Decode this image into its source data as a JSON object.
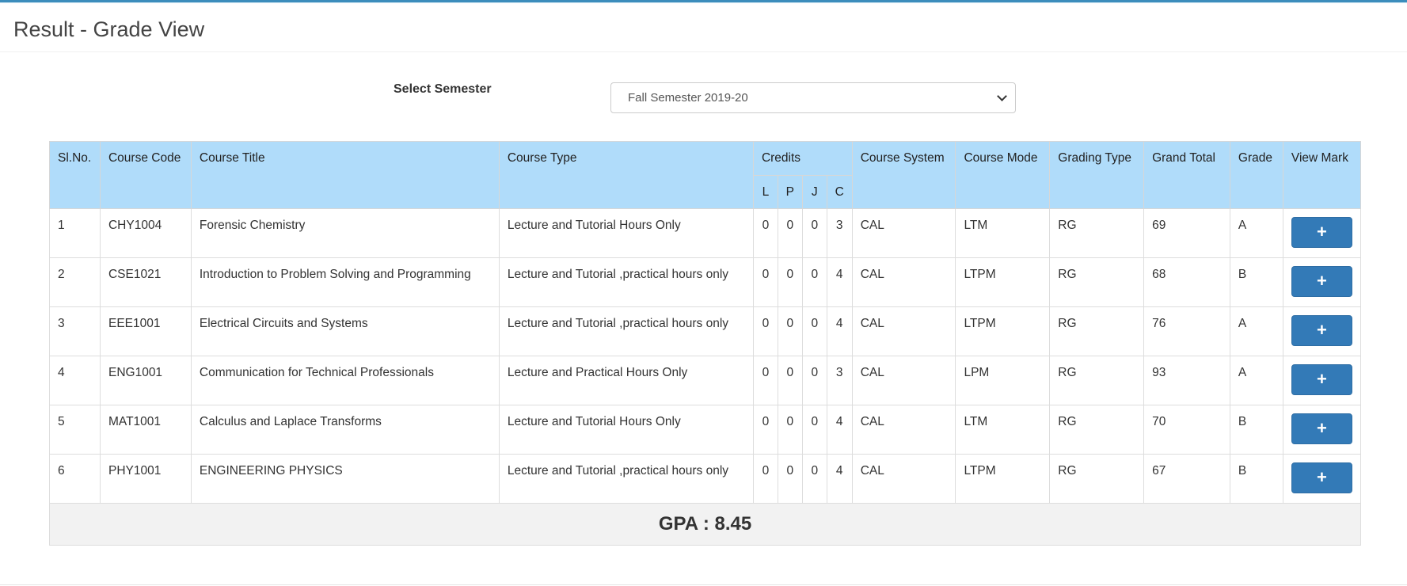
{
  "page": {
    "title": "Result - Grade View"
  },
  "semester": {
    "label": "Select Semester",
    "selected": "Fall Semester 2019-20"
  },
  "table": {
    "headers": {
      "slno": "Sl.No.",
      "course_code": "Course Code",
      "course_title": "Course Title",
      "course_type": "Course Type",
      "credits": "Credits",
      "credits_l": "L",
      "credits_p": "P",
      "credits_j": "J",
      "credits_c": "C",
      "course_system": "Course System",
      "course_mode": "Course Mode",
      "grading_type": "Grading Type",
      "grand_total": "Grand Total",
      "grade": "Grade",
      "view_mark": "View Mark"
    },
    "rows": [
      {
        "slno": "1",
        "code": "CHY1004",
        "title": "Forensic Chemistry",
        "type": "Lecture and Tutorial Hours Only",
        "l": "0",
        "p": "0",
        "j": "0",
        "c": "3",
        "system": "CAL",
        "mode": "LTM",
        "grading": "RG",
        "total": "69",
        "grade": "A"
      },
      {
        "slno": "2",
        "code": "CSE1021",
        "title": "Introduction to Problem Solving and Programming",
        "type": "Lecture and Tutorial ,practical hours only",
        "l": "0",
        "p": "0",
        "j": "0",
        "c": "4",
        "system": "CAL",
        "mode": "LTPM",
        "grading": "RG",
        "total": "68",
        "grade": "B"
      },
      {
        "slno": "3",
        "code": "EEE1001",
        "title": "Electrical Circuits and Systems",
        "type": "Lecture and Tutorial ,practical hours only",
        "l": "0",
        "p": "0",
        "j": "0",
        "c": "4",
        "system": "CAL",
        "mode": "LTPM",
        "grading": "RG",
        "total": "76",
        "grade": "A"
      },
      {
        "slno": "4",
        "code": "ENG1001",
        "title": "Communication for Technical Professionals",
        "type": "Lecture and Practical Hours Only",
        "l": "0",
        "p": "0",
        "j": "0",
        "c": "3",
        "system": "CAL",
        "mode": "LPM",
        "grading": "RG",
        "total": "93",
        "grade": "A"
      },
      {
        "slno": "5",
        "code": "MAT1001",
        "title": "Calculus and Laplace Transforms",
        "type": "Lecture and Tutorial Hours Only",
        "l": "0",
        "p": "0",
        "j": "0",
        "c": "4",
        "system": "CAL",
        "mode": "LTM",
        "grading": "RG",
        "total": "70",
        "grade": "B"
      },
      {
        "slno": "6",
        "code": "PHY1001",
        "title": "ENGINEERING PHYSICS",
        "type": "Lecture and Tutorial ,practical hours only",
        "l": "0",
        "p": "0",
        "j": "0",
        "c": "4",
        "system": "CAL",
        "mode": "LTPM",
        "grading": "RG",
        "total": "67",
        "grade": "B"
      }
    ],
    "view_button_label": "+",
    "gpa": "GPA : 8.45"
  },
  "colors": {
    "header_bg": "#b0dcfa",
    "button_bg": "#337ab7",
    "top_bar": "#3c8dbc",
    "gpa_bg": "#f2f2f2"
  }
}
